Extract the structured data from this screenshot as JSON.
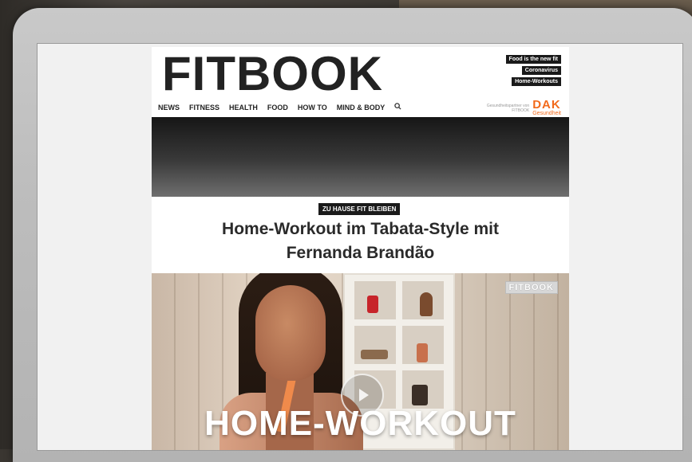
{
  "site": {
    "logo": "FITBOOK",
    "quick_links": [
      "Food is the new fit",
      "Coronavirus",
      "Home-Workouts"
    ],
    "nav": [
      "NEWS",
      "FITNESS",
      "HEALTH",
      "FOOD",
      "HOW TO",
      "MIND & BODY"
    ],
    "search_icon": "search-icon",
    "partner_text": "Gesundheitspartner von FITBOOK",
    "partner_logo": "DAK",
    "partner_logo_sub": "Gesundheit",
    "partner_color": "#f26a1b"
  },
  "article": {
    "category": "ZU HAUSE FIT BLEIBEN",
    "headline": "Home-Workout im Tabata-Style mit Fernanda Brandão"
  },
  "video": {
    "watermark": "FITBOOK",
    "title": "HOME-WORKOUT",
    "play_icon": "play-icon"
  }
}
